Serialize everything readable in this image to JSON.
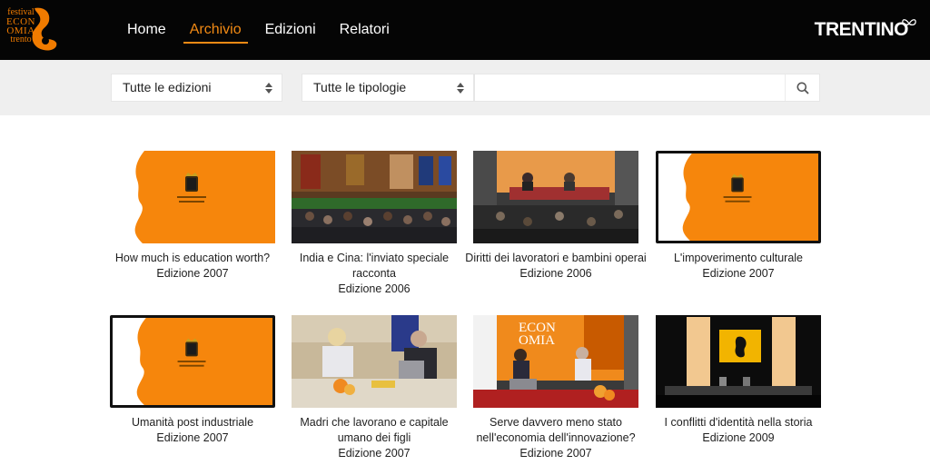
{
  "header": {
    "logo": {
      "line1": "festival",
      "line2": "ECON",
      "line3": "OMIA",
      "line4": "trento"
    },
    "nav": [
      {
        "label": "Home",
        "active": false
      },
      {
        "label": "Archivio",
        "active": true
      },
      {
        "label": "Edizioni",
        "active": false
      },
      {
        "label": "Relatori",
        "active": false
      }
    ],
    "brand": "TRENTINO"
  },
  "filters": {
    "edition": {
      "selected": "Tutte le edizioni"
    },
    "type": {
      "selected": "Tutte le tipologie"
    },
    "search": {
      "placeholder": "",
      "value": "",
      "icon": "search-icon"
    }
  },
  "colors": {
    "accent": "#f28a14",
    "header_bg": "#050505",
    "filter_bg": "#efefef",
    "orange_thumb": "#f6860c"
  },
  "cards": [
    {
      "title": "How much is education worth?",
      "edition": "Edizione 2007",
      "thumb": "orange-crest"
    },
    {
      "title": "India e Cina: l'inviato speciale racconta",
      "edition": "Edizione 2006",
      "thumb": "hall-audience"
    },
    {
      "title": "Diritti dei lavoratori e bambini operai",
      "edition": "Edizione 2006",
      "thumb": "stage-panel"
    },
    {
      "title": "L'impoverimento culturale",
      "edition": "Edizione 2007",
      "thumb": "orange-crest"
    },
    {
      "title": "Umanità post industriale",
      "edition": "Edizione 2007",
      "thumb": "orange-crest"
    },
    {
      "title": "Madri che lavorano e capitale umano dei figli",
      "edition": "Edizione 2007",
      "thumb": "speakers-desk"
    },
    {
      "title": "Serve davvero meno stato nell'economia dell'innovazione?",
      "edition": "Edizione 2007",
      "thumb": "economia-stage"
    },
    {
      "title": "I conflitti d'identità nella storia",
      "edition": "Edizione 2009",
      "thumb": "dark-theatre"
    }
  ]
}
